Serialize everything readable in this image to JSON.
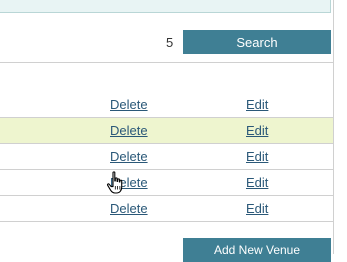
{
  "pager": {
    "count": "5",
    "search_label": "Search"
  },
  "table": {
    "rows": [
      {
        "delete_label": "Delete",
        "edit_label": "Edit",
        "highlighted": false
      },
      {
        "delete_label": "Delete",
        "edit_label": "Edit",
        "highlighted": true
      },
      {
        "delete_label": "Delete",
        "edit_label": "Edit",
        "highlighted": false
      },
      {
        "delete_label": "Delete",
        "edit_label": "Edit",
        "highlighted": false
      },
      {
        "delete_label": "Delete",
        "edit_label": "Edit",
        "highlighted": false
      }
    ]
  },
  "footer": {
    "add_venue_label": "Add New Venue"
  },
  "cursor": {
    "icon": "hand-pointer-icon"
  },
  "colors": {
    "button_bg": "#3f7f94",
    "link": "#2a5878",
    "highlight_row": "#eef5cf",
    "top_panel": "#e8f4f4"
  }
}
